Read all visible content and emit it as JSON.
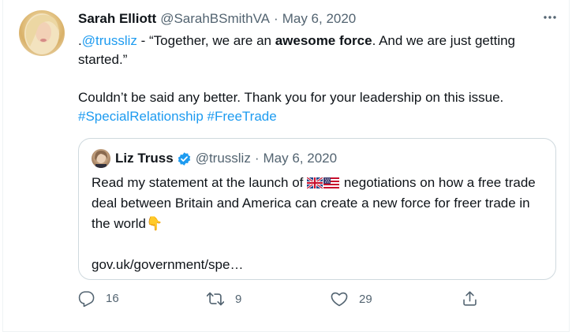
{
  "tweet": {
    "author_name": "Sarah Elliott",
    "handle": "@SarahBSmithVA",
    "separator": "·",
    "date": "May 6, 2020",
    "text_parts": {
      "p1_lead": ".",
      "p1_mention": "@trussliz",
      "p1_a": " - “Together, we are an ",
      "p1_bold": "awesome force",
      "p1_b": ". And we are just getting started.”",
      "p2": "Couldn’t be said any better. Thank you for your leadership on this issue.",
      "hashtag1": "#SpecialRelationship",
      "hashtag_space": " ",
      "hashtag2": "#FreeTrade"
    }
  },
  "quoted_tweet": {
    "author_name": "Liz Truss",
    "handle": "@trussliz",
    "separator": "·",
    "date": "May 6, 2020",
    "text_a": "Read my statement at the launch of ",
    "flags": [
      "uk-flag-icon",
      "us-flag-icon"
    ],
    "text_b": " negotiations on how a free trade deal between Britain and America can create a new force for freer trade in the world",
    "emoji": "👇",
    "link": "gov.uk/government/spe…"
  },
  "actions": {
    "replies": "16",
    "retweets": "9",
    "likes": "29"
  },
  "colors": {
    "link": "#1d9bf0",
    "secondary": "#536471",
    "border": "#cfd9de"
  }
}
